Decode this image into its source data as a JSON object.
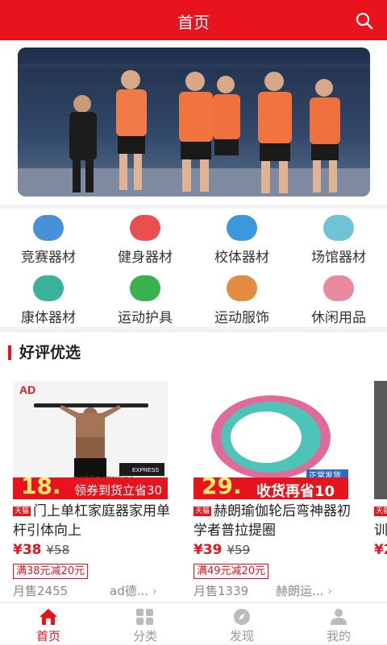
{
  "header": {
    "title": "首页"
  },
  "categories": [
    {
      "label": "竞赛器材",
      "icon": "trophy-icon",
      "color": "#4a90d9"
    },
    {
      "label": "健身器材",
      "icon": "dumbbell-icon",
      "color": "#e94f4f"
    },
    {
      "label": "校体器材",
      "icon": "school-icon",
      "color": "#3a9ad9"
    },
    {
      "label": "场馆器材",
      "icon": "court-icon",
      "color": "#6fc3d6"
    },
    {
      "label": "康体器材",
      "icon": "yoga-icon",
      "color": "#3ab39c"
    },
    {
      "label": "运动护具",
      "icon": "kneepad-icon",
      "color": "#37b24d"
    },
    {
      "label": "运动服饰",
      "icon": "shirt-icon",
      "color": "#e38b3e"
    },
    {
      "label": "休闲用品",
      "icon": "umbrella-icon",
      "color": "#e98aa0"
    }
  ],
  "section": {
    "title": "好评优选"
  },
  "products": [
    {
      "brand_text": "AD",
      "banner_price": "18.",
      "banner_text": "领券到货立省30",
      "banner_small": "送运动手套  5重加固安全",
      "express": "EXPRESS",
      "tmall": "天猫",
      "name": "门上单杠家庭器家用单杆引体向上",
      "price": "¥38",
      "orig_price": "¥58",
      "coupon": "满38元减20元",
      "sold": "月售2455",
      "shop": "ad德..."
    },
    {
      "banner_price": "29.",
      "banner_text": "收货再省10",
      "banner_tag": "正常发货",
      "tmall": "天猫",
      "name": "赫朗瑜伽轮后弯神器初学者普拉提圈",
      "price": "¥39",
      "orig_price": "¥59",
      "coupon": "满49元减20元",
      "sold": "月售1339",
      "shop": "赫朗运..."
    },
    {
      "tmall": "天猫",
      "name": "训",
      "price": "¥2"
    }
  ],
  "tabs": [
    {
      "label": "首页",
      "icon": "home-icon",
      "active": true
    },
    {
      "label": "分类",
      "icon": "grid-icon",
      "active": false
    },
    {
      "label": "发现",
      "icon": "compass-icon",
      "active": false
    },
    {
      "label": "我的",
      "icon": "user-icon",
      "active": false
    }
  ],
  "colors": {
    "accent": "#e8131c",
    "text": "#333333",
    "muted": "#999999"
  }
}
